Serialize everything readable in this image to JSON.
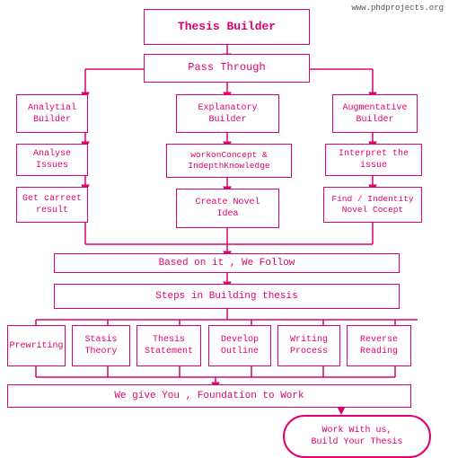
{
  "watermark": "www.phdprojects.org",
  "boxes": {
    "thesis_builder": {
      "label": "Thesis Builder"
    },
    "pass_through": {
      "label": "Pass Through"
    },
    "analytical": {
      "label": "Analytial\nBuilder"
    },
    "explanatory": {
      "label": "Explanatory\nBuilder"
    },
    "augmentative": {
      "label": "Augmentative\nBuilder"
    },
    "analyse_issues": {
      "label": "Analyse Issues"
    },
    "workon": {
      "label": "workonConcept &\nIndepthKnowledge"
    },
    "interpret": {
      "label": "Interpret the\nissue"
    },
    "get_carret": {
      "label": "Get carreet\nresult"
    },
    "create_novel": {
      "label": "Create Novel\nIdea"
    },
    "find_indentity": {
      "label": "Find / Indentity\nNovel Cocept"
    },
    "based_on": {
      "label": "Based on it , We Follow"
    },
    "steps": {
      "label": "Steps in Building thesis"
    },
    "prewriting": {
      "label": "Prewriting"
    },
    "stasis": {
      "label": "Stasis\nTheory"
    },
    "thesis_statement": {
      "label": "Thesis\nStatement"
    },
    "develop_outline": {
      "label": "Develop\nOutline"
    },
    "writing_process": {
      "label": "Writing\nProcess"
    },
    "reverse_reading": {
      "label": "Reverse\nReading"
    },
    "foundation": {
      "label": "We give You , Foundation to Work"
    },
    "work_with": {
      "label": "Work With us,\nBuild Your Thesis"
    }
  }
}
